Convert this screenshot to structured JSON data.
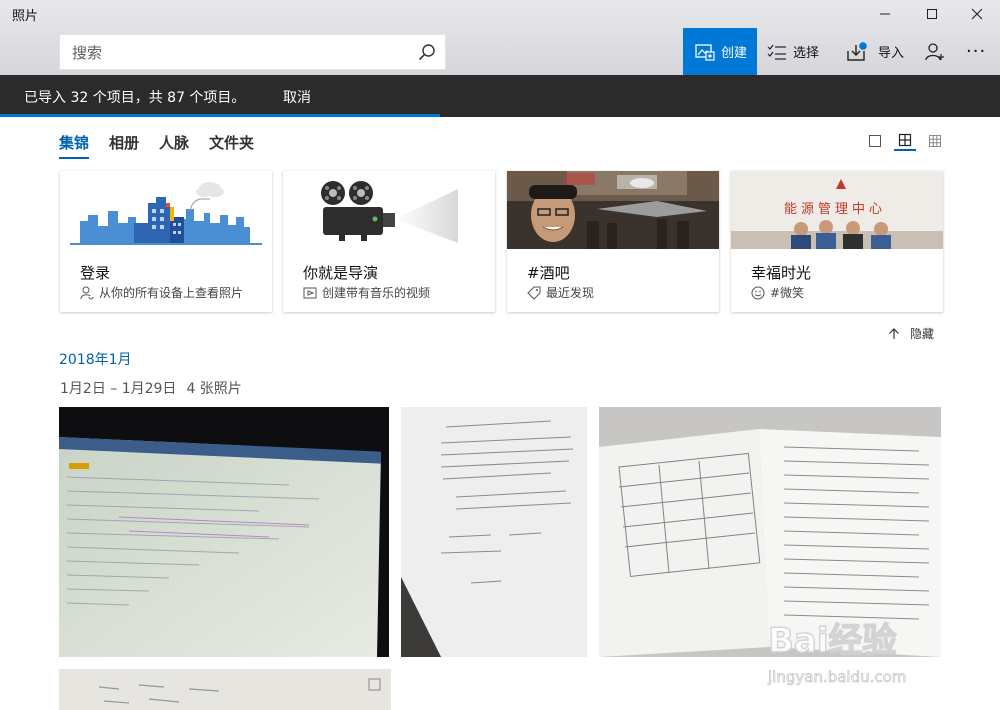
{
  "window": {
    "title": "照片"
  },
  "search": {
    "placeholder": "搜索"
  },
  "toolbar": {
    "create_label": "创建",
    "select_label": "选择",
    "import_label": "导入",
    "more_label": "···"
  },
  "banner": {
    "message": "已导入 32 个项目，共 87 个项目。",
    "cancel_label": "取消",
    "progress_fraction": 0.44
  },
  "tabs": [
    {
      "label": "集锦",
      "active": true
    },
    {
      "label": "相册",
      "active": false
    },
    {
      "label": "人脉",
      "active": false
    },
    {
      "label": "文件夹",
      "active": false
    }
  ],
  "cards": [
    {
      "title": "登录",
      "subtitle": "从你的所有设备上查看照片",
      "icon": "person-sync-icon"
    },
    {
      "title": "你就是导演",
      "subtitle": "创建带有音乐的视频",
      "icon": "video-icon"
    },
    {
      "title": "#酒吧",
      "subtitle": "最近发现",
      "icon": "tag-icon"
    },
    {
      "title": "幸福时光",
      "subtitle": "#微笑",
      "icon": "smile-icon"
    }
  ],
  "hide": {
    "label": "隐藏"
  },
  "section": {
    "month": "2018年1月",
    "date_range": "1月2日 – 1月29日",
    "photo_count": "4 张照片"
  },
  "banner_art": {
    "hall_sign": "能源管理中心"
  },
  "watermark": {
    "brand": "Bai经验",
    "url": "jingyan.baidu.com"
  },
  "colors": {
    "accent": "#0078d7",
    "banner_bg": "#2b2b2b"
  }
}
